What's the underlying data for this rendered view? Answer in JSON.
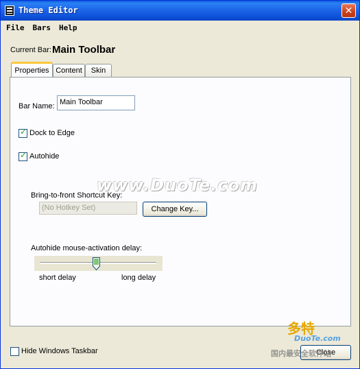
{
  "window": {
    "title": "Theme Editor",
    "close_glyph": "✕"
  },
  "menu": [
    "File",
    "Bars",
    "Help"
  ],
  "current_bar": {
    "label": "Current Bar:",
    "value": "Main Toolbar"
  },
  "tabs": [
    {
      "label": "Properties",
      "active": true
    },
    {
      "label": "Content",
      "active": false
    },
    {
      "label": "Skin",
      "active": false
    }
  ],
  "properties": {
    "bar_name_label": "Bar Name:",
    "bar_name_value": "Main Toolbar",
    "dock_to_edge": {
      "label": "Dock to Edge",
      "checked": true
    },
    "autohide": {
      "label": "Autohide",
      "checked": true
    },
    "shortcut": {
      "label": "Bring-to-front Shortcut Key:",
      "value": "(No Hotkey Set)",
      "change_button": "Change Key..."
    },
    "delay": {
      "label": "Autohide mouse-activation delay:",
      "min_label": "short delay",
      "max_label": "long delay",
      "position_fraction": 0.46
    }
  },
  "footer": {
    "hide_taskbar": {
      "label": "Hide Windows Taskbar",
      "checked": false
    },
    "close_button": "Close"
  },
  "watermark": {
    "main": "www.DuoTe.com",
    "logo_line1": "多特",
    "logo_line2": "DuoTe.com",
    "logo_line3": "国内最安全软件站"
  },
  "icons": {
    "app": "film-icon",
    "close": "close-icon",
    "check": "checkmark-icon",
    "slider": "slider-thumb-icon"
  },
  "colors": {
    "titlebar": "#0a5bdb",
    "close_button": "#c9401c",
    "window_bg": "#ece9d8",
    "tab_accent": "#ffc83c",
    "check": "#21a121"
  }
}
